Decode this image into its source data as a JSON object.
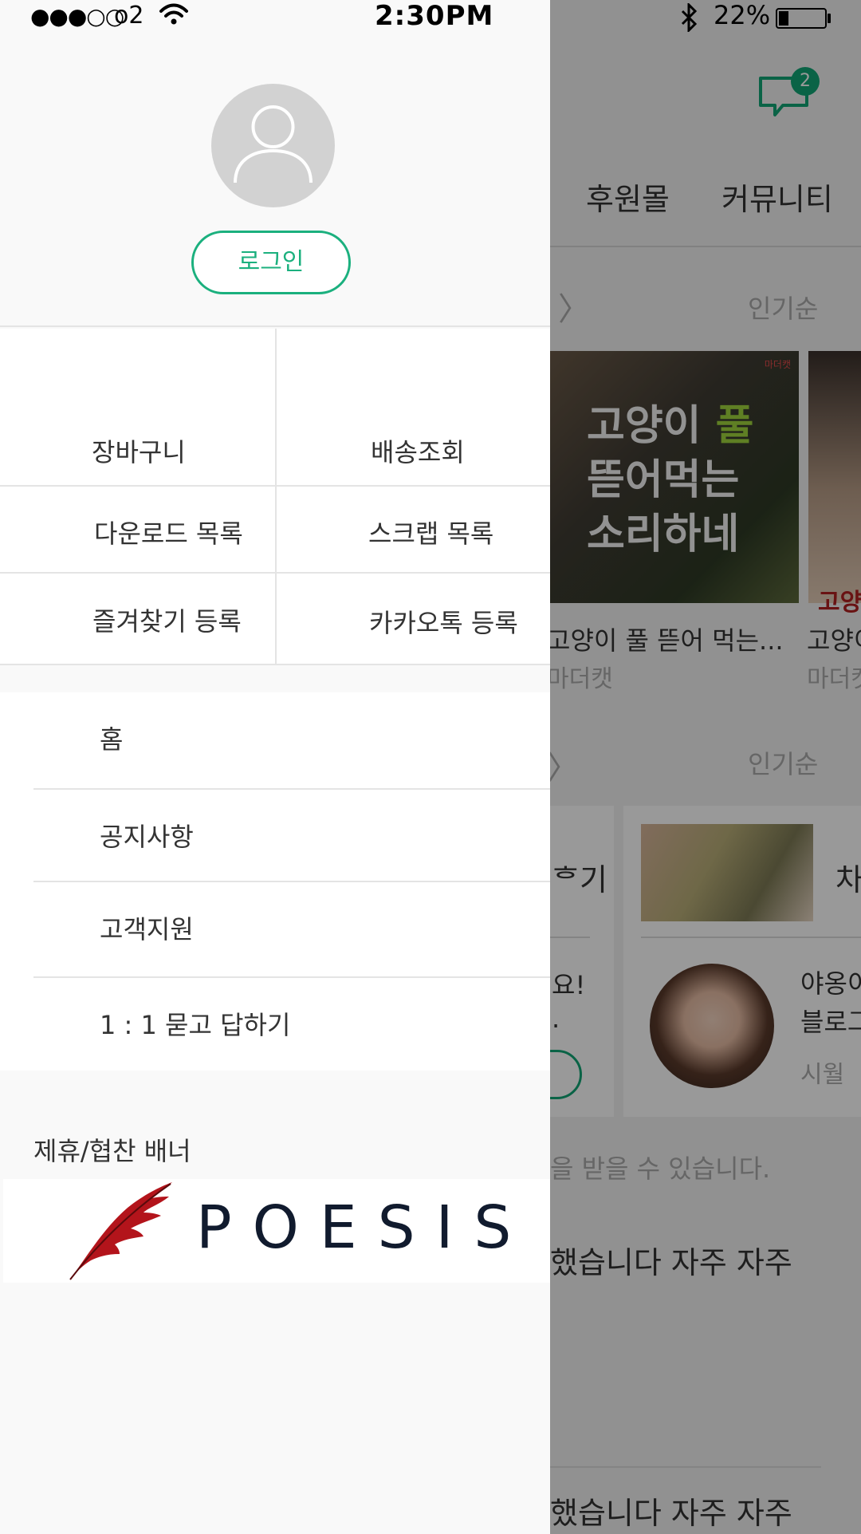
{
  "status_bar": {
    "signal": "●●●○○",
    "carrier": "o2",
    "time": "2:30PM",
    "bluetooth": "✱",
    "battery_percent": "22%",
    "battery_level": 0.22
  },
  "background": {
    "chat_badge": "2",
    "nav": [
      "후원몰",
      "커뮤니티"
    ],
    "sort_label_1": "인기순",
    "sort_label_2": "인기순",
    "thumb1_lines": [
      "고양이",
      "풀",
      "뜯어먹는",
      "소리하네"
    ],
    "thumb1_tag": "마더캣",
    "thumb2_text": "고양이",
    "post1_title": "고양이 풀 뜯어 먹는...",
    "post1_author": "마더캣",
    "post2_title": "고양이",
    "post2_author": "마더캣",
    "card_left_title": "ᄒ기",
    "card_left_text_1": "요!",
    "card_left_text_2": ".",
    "card_right_title": "차",
    "card_right_text_1": "야옹이",
    "card_right_text_2": "블로그",
    "card_right_author": "시월",
    "notice": "을 받을 수 있습니다.",
    "feed_text_1": "했습니다 자주 자주",
    "feed_text_2": "했습니다 자주 자주"
  },
  "drawer": {
    "login_label": "로그인",
    "grid": [
      {
        "label": "장바구니"
      },
      {
        "label": "배송조회"
      },
      {
        "label": "다운로드 목록"
      },
      {
        "label": "스크랩 목록"
      },
      {
        "label": "즐겨찾기 등록"
      },
      {
        "label": "카카오톡 등록"
      }
    ],
    "menu": [
      {
        "label": "홈"
      },
      {
        "label": "공지사항"
      },
      {
        "label": "고객지원"
      },
      {
        "label": "1 : 1 묻고 답하기"
      }
    ],
    "banner_label": "제휴/협찬 배너",
    "banner_text": "POESIS"
  },
  "colors": {
    "accent": "#1bb07e",
    "badge": "#11a676",
    "overlay": "rgba(0,0,0,0.40)",
    "banner_text": "#111b2e",
    "quill": "#b3141b"
  },
  "icons": {
    "avatar": "person-placeholder-icon",
    "chat": "chat-bubble-icon",
    "wifi": "wifi-icon",
    "bluetooth": "bluetooth-icon",
    "battery": "battery-icon",
    "chevron": "chevron-right-icon",
    "banner_logo": "quill-icon"
  }
}
